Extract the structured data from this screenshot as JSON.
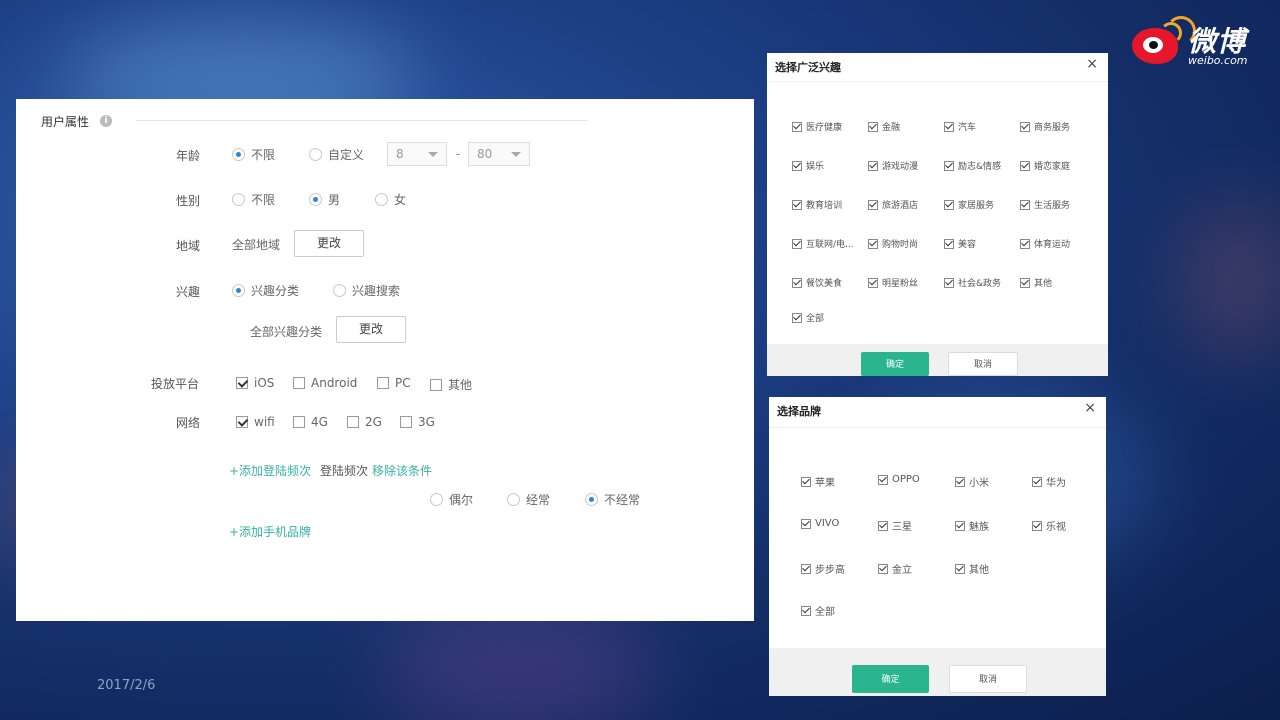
{
  "logo": {
    "text": "微博",
    "sub": "weibo.com"
  },
  "date": "2017/2/6",
  "user_attrs": {
    "section_title": "用户属性",
    "info_glyph": "i",
    "age": {
      "label": "年龄",
      "unlimited": "不限",
      "custom": "自定义",
      "min": "8",
      "dash": "-",
      "max": "80",
      "selected": "unlimited"
    },
    "gender": {
      "label": "性别",
      "unlimited": "不限",
      "male": "男",
      "female": "女",
      "selected": "male"
    },
    "region": {
      "label": "地域",
      "value": "全部地域",
      "change_btn": "更改"
    },
    "interest": {
      "label": "兴趣",
      "category": "兴趣分类",
      "search": "兴趣搜索",
      "selected": "category",
      "value": "全部兴趣分类",
      "change_btn": "更改"
    },
    "platform": {
      "label": "投放平台",
      "options": [
        {
          "name": "iOS",
          "checked": true
        },
        {
          "name": "Android",
          "checked": false
        },
        {
          "name": "PC",
          "checked": false
        },
        {
          "name": "其他",
          "checked": false
        }
      ]
    },
    "network": {
      "label": "网络",
      "options": [
        {
          "name": "wifi",
          "checked": true
        },
        {
          "name": "4G",
          "checked": false
        },
        {
          "name": "2G",
          "checked": false
        },
        {
          "name": "3G",
          "checked": false
        }
      ]
    },
    "add_login_freq": "+添加登陆频次",
    "login_freq_label": "登陆频次",
    "remove_condition": "移除该条件",
    "freq": {
      "occasional": "偶尔",
      "often": "经常",
      "rarely": "不经常",
      "selected": "rarely"
    },
    "add_phone_brand": "+添加手机品牌"
  },
  "interest_dialog": {
    "title": "选择广泛兴趣",
    "close": "×",
    "items": [
      "医疗健康",
      "金融",
      "汽车",
      "商务服务",
      "娱乐",
      "游戏动漫",
      "励志&情感",
      "婚恋家庭",
      "教育培训",
      "旅游酒店",
      "家居服务",
      "生活服务",
      "互联网/电...",
      "购物时尚",
      "美容",
      "体育运动",
      "餐饮美食",
      "明星粉丝",
      "社会&政务",
      "其他",
      "全部"
    ],
    "ok": "确定",
    "cancel": "取消"
  },
  "brand_dialog": {
    "title": "选择品牌",
    "close": "×",
    "items": [
      "苹果",
      "OPPO",
      "小米",
      "华为",
      "VIVO",
      "三星",
      "魅族",
      "乐视",
      "步步高",
      "金立",
      "其他",
      "全部"
    ],
    "ok": "确定",
    "cancel": "取消"
  }
}
